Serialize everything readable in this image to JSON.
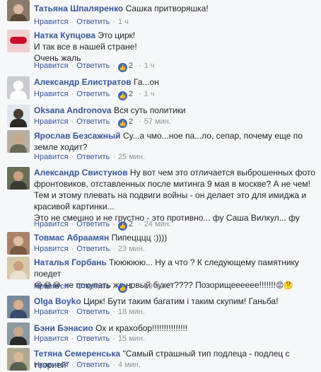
{
  "actions": {
    "like": "Нравится",
    "reply": "Ответить",
    "sep": "·"
  },
  "colors": {
    "name": "#365899",
    "meta": "#90949c",
    "like_badge": "#4267b2"
  },
  "comments": [
    {
      "author": "Татьяна Шпаляренко",
      "text": "Сашка притворяшка!",
      "time": "1 ч"
    },
    {
      "author": "Натка Купцова",
      "lines": [
        "Это цирк!",
        "И так все в нашей стране!",
        "Очень жаль"
      ],
      "likes": "2",
      "time": "1 ч"
    },
    {
      "author": "Александр Елистратов",
      "text": "Га...он",
      "likes": "2",
      "time": "1 ч"
    },
    {
      "author": "Oksana Andronova",
      "text": "Вся суть политики",
      "likes": "2",
      "time": "57 мин."
    },
    {
      "author": "Ярослав Безсажный",
      "text": "Су...а чмо...ное па...ло, сепар, почему еще по земле ходит?",
      "time": "25 мин."
    },
    {
      "author": "Александр Свистунов",
      "text": "Ну вот чем это отличается выброшенных фото фронтовиков, отставленных после митинга 9 мая в москве? А не чем! Тем и этому плевать на подвиги войны - он делает это для имиджа и красивой картинки...",
      "text2": "Это не смешно и не грустно - это противно... фу Саша Вилкул... фу",
      "likes": "2",
      "time": "24 мин."
    },
    {
      "author": "Товмас Абраамян",
      "text": "Пипецццц :))))",
      "time": "23 мин."
    },
    {
      "author": "Наталья Горбань",
      "text": "Тююююю... Ну а что ? К следующему памятнику поедет",
      "text2": "не покупать же новый букет???? Позорищееееее!!!!!!!",
      "likes": "1",
      "time": "19 мин.",
      "emoji_before": "😂😂😂",
      "emoji_after": "😡🤔"
    },
    {
      "author": "Olga Boyko",
      "text": "Цирк! Бути таким багатим і таким скупим! Ганьба!",
      "time": "18 мин."
    },
    {
      "author": "Бэни Бэнасио",
      "text": "Ох и крахобор!!!!!!!!!!!!!!!",
      "time": "15 мин."
    },
    {
      "author": "Тетяна Семеренська",
      "text": "\"Самый страшный тип подлеца - подлец с теорией\"",
      "time": "4 мин."
    }
  ]
}
